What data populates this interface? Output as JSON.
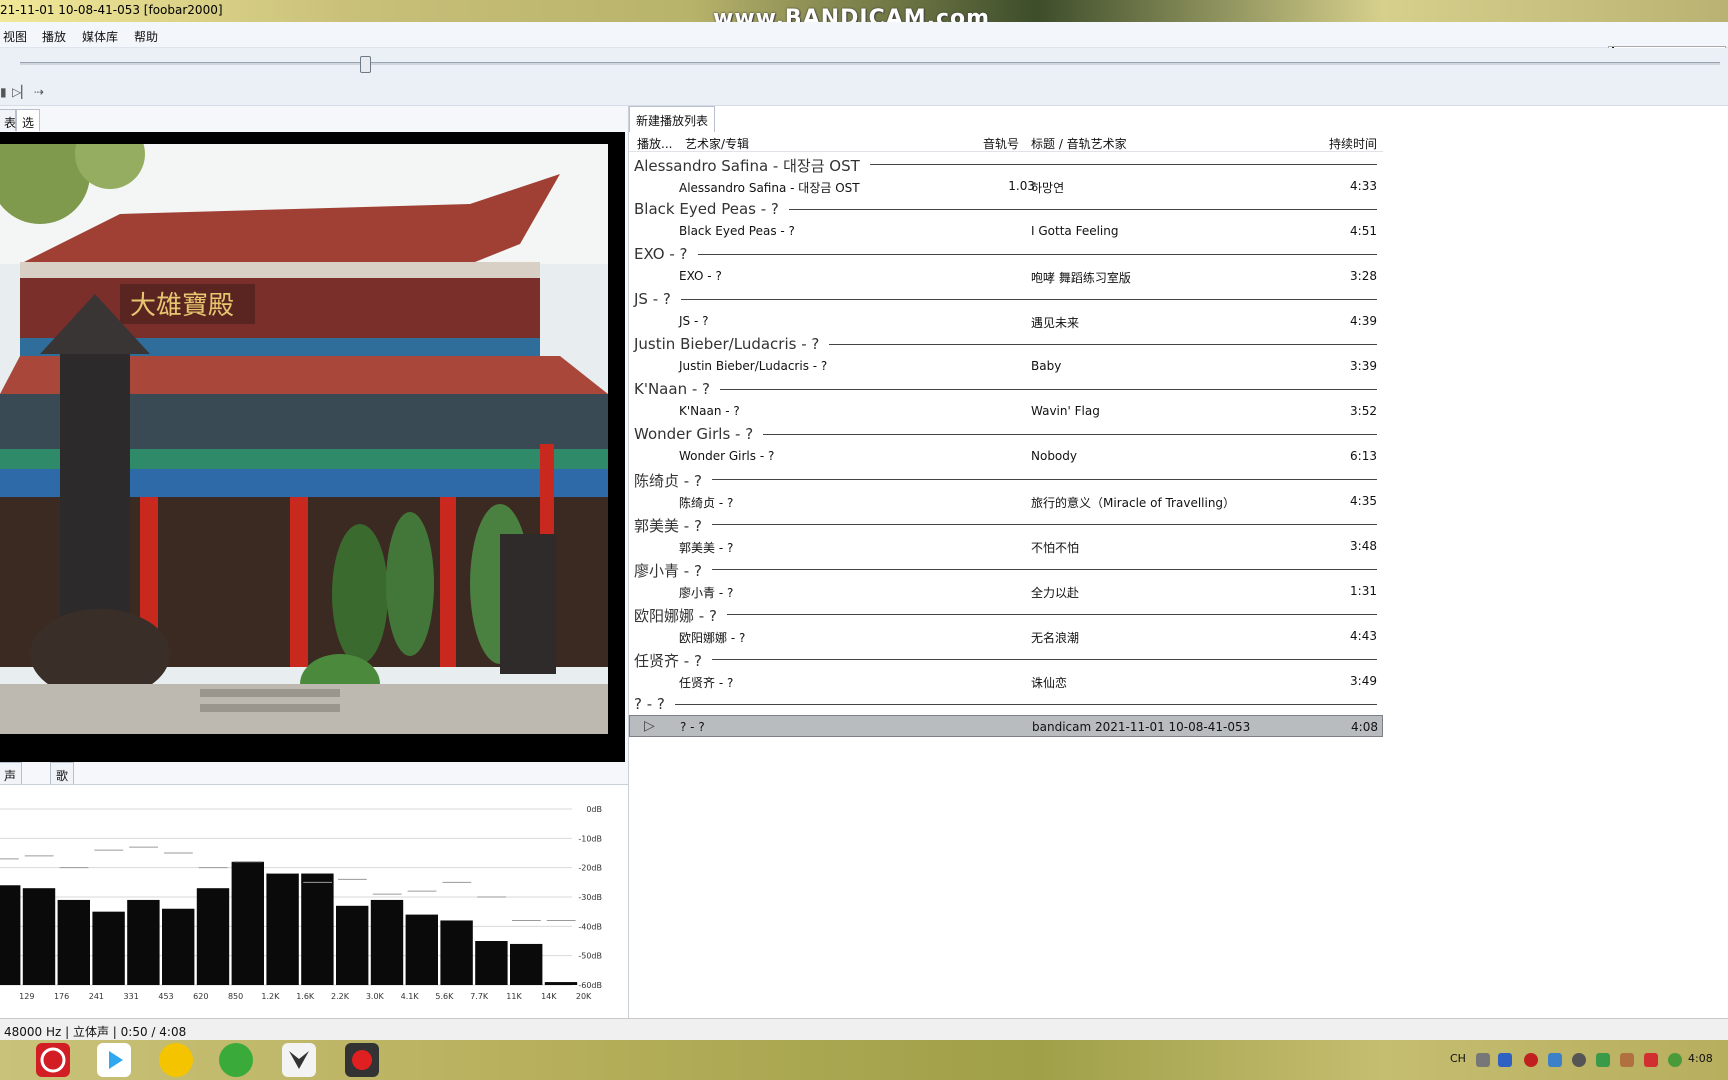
{
  "window": {
    "title": "21-11-01 10-08-41-053  [foobar2000]"
  },
  "watermark": "www.BANDICAM.com",
  "menu": [
    "视图",
    "播放",
    "媒体库",
    "帮助"
  ],
  "left_tabs": {
    "tab1": "表",
    "tab2": "选择项属性"
  },
  "bottom_tabs": {
    "tab1": "声量计",
    "tab2": "歌词"
  },
  "spectrum": {
    "db_labels": [
      "0dB",
      "-10dB",
      "-20dB",
      "-30dB",
      "-40dB",
      "-50dB",
      "-60dB"
    ],
    "freq_labels": [
      "129",
      "176",
      "241",
      "331",
      "453",
      "620",
      "850",
      "1.2K",
      "1.6K",
      "2.2K",
      "3.0K",
      "4.1K",
      "5.6K",
      "7.7K",
      "11K",
      "14K",
      "20K"
    ],
    "bar_db": [
      -26,
      -27,
      -31,
      -35,
      -31,
      -34,
      -27,
      -18,
      -22,
      -22,
      -33,
      -31,
      -36,
      -38,
      -45,
      -46,
      -59
    ],
    "peak_db": [
      -17,
      -16,
      -20,
      -14,
      -13,
      -15,
      -20,
      -18,
      -22,
      -25,
      -24,
      -29,
      -28,
      -25,
      -30,
      -38,
      -38
    ]
  },
  "playlist": {
    "tab": "新建播放列表",
    "columns": {
      "playing": "播放...",
      "artist_album": "艺术家/专辑",
      "track_no": "音轨号",
      "title_artist": "标题 / 音轨艺术家",
      "duration": "持续时间"
    },
    "groups": [
      {
        "name": "Alessandro Safina - 대장금 OST",
        "tracks": [
          {
            "artist_album": "Alessandro Safina - 대장금 OST",
            "track_no": "1.03",
            "title": "하망연",
            "duration": "4:33"
          }
        ]
      },
      {
        "name": "Black Eyed Peas - ?",
        "tracks": [
          {
            "artist_album": "Black Eyed Peas - ?",
            "track_no": "",
            "title": "I Gotta Feeling",
            "duration": "4:51"
          }
        ]
      },
      {
        "name": "EXO - ?",
        "tracks": [
          {
            "artist_album": "EXO - ?",
            "track_no": "",
            "title": "咆哮 舞蹈练习室版",
            "duration": "3:28"
          }
        ]
      },
      {
        "name": "JS - ?",
        "tracks": [
          {
            "artist_album": "JS - ?",
            "track_no": "",
            "title": "遇见未来",
            "duration": "4:39"
          }
        ]
      },
      {
        "name": "Justin Bieber/Ludacris - ?",
        "tracks": [
          {
            "artist_album": "Justin Bieber/Ludacris - ?",
            "track_no": "",
            "title": "Baby",
            "duration": "3:39"
          }
        ]
      },
      {
        "name": "K'Naan - ?",
        "tracks": [
          {
            "artist_album": "K'Naan - ?",
            "track_no": "",
            "title": "Wavin' Flag",
            "duration": "3:52"
          }
        ]
      },
      {
        "name": "Wonder Girls - ?",
        "tracks": [
          {
            "artist_album": "Wonder Girls - ?",
            "track_no": "",
            "title": "Nobody",
            "duration": "6:13"
          }
        ]
      },
      {
        "name": "陈绮贞 - ?",
        "tracks": [
          {
            "artist_album": "陈绮贞 - ?",
            "track_no": "",
            "title": "旅行的意义（Miracle of Travelling）",
            "duration": "4:35"
          }
        ]
      },
      {
        "name": "郭美美 - ?",
        "tracks": [
          {
            "artist_album": "郭美美 - ?",
            "track_no": "",
            "title": "不怕不怕",
            "duration": "3:48"
          }
        ]
      },
      {
        "name": "廖小青 - ?",
        "tracks": [
          {
            "artist_album": "廖小青 - ?",
            "track_no": "",
            "title": "全力以赴",
            "duration": "1:31"
          }
        ]
      },
      {
        "name": "欧阳娜娜 - ?",
        "tracks": [
          {
            "artist_album": "欧阳娜娜 - ?",
            "track_no": "",
            "title": "无名浪潮",
            "duration": "4:43"
          }
        ]
      },
      {
        "name": "任贤齐 - ?",
        "tracks": [
          {
            "artist_album": "任贤齐 - ?",
            "track_no": "",
            "title": "诛仙恋",
            "duration": "3:49"
          }
        ]
      },
      {
        "name": "? - ?",
        "tracks": [
          {
            "artist_album": "? - ?",
            "track_no": "",
            "title": "bandicam 2021-11-01 10-08-41-053",
            "duration": "4:08",
            "playing": true
          }
        ]
      }
    ]
  },
  "status": "48000 Hz | 立体声 | 0:50 / 4:08",
  "seek": {
    "position_fraction": 0.2
  },
  "tray": {
    "lang": "CH",
    "clock": "4:08"
  },
  "colors": {
    "playing_row": "#b9bcbf",
    "accent": "#4a8fd8"
  }
}
